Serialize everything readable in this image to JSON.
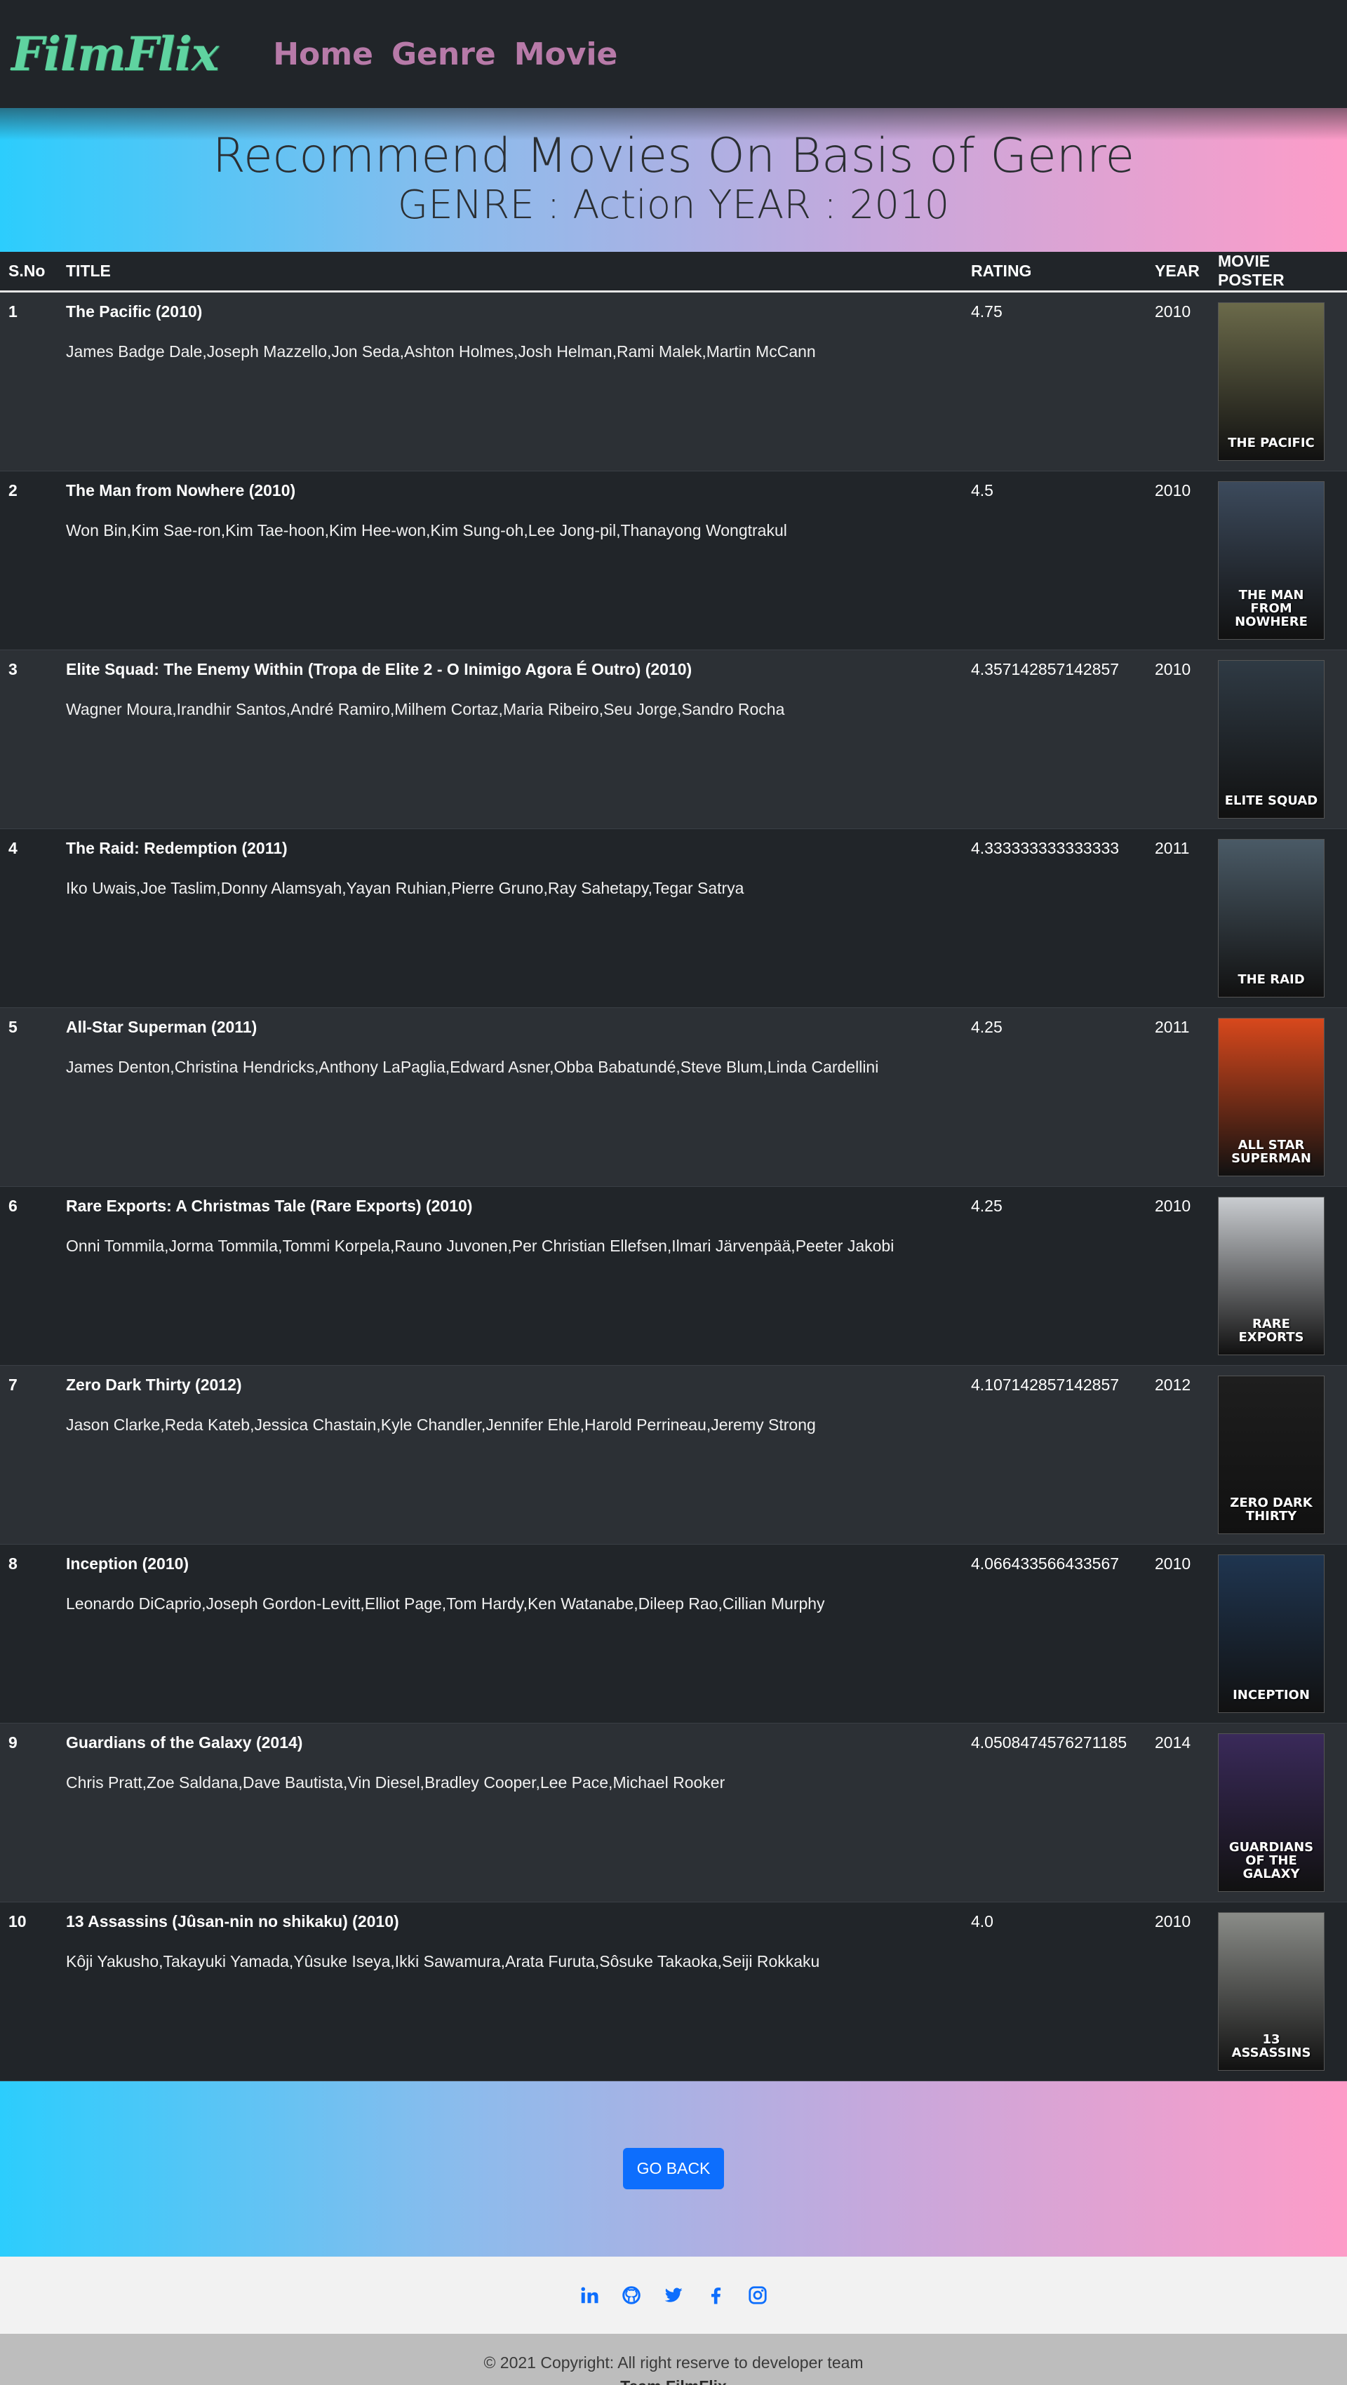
{
  "nav": {
    "brand": "FilmFlix",
    "links": [
      "Home",
      "Genre",
      "Movie"
    ]
  },
  "hero": {
    "title": "Recommend Movies On Basis of Genre",
    "subtitle": "GENRE : Action YEAR : 2010"
  },
  "table": {
    "headers": [
      "S.No",
      "TITLE",
      "RATING",
      "YEAR",
      "MOVIE POSTER"
    ],
    "rows": [
      {
        "sno": "1",
        "title": "The Pacific (2010)",
        "cast": "James Badge Dale,Joseph Mazzello,Jon Seda,Ashton Holmes,Josh Helman,Rami Malek,Martin McCann",
        "rating": "4.75",
        "year": "2010",
        "poster_label": "THE PACIFIC",
        "poster_color": "#6b6a4a"
      },
      {
        "sno": "2",
        "title": "The Man from Nowhere (2010)",
        "cast": "Won Bin,Kim Sae-ron,Kim Tae-hoon,Kim Hee-won,Kim Sung-oh,Lee Jong-pil,Thanayong Wongtrakul",
        "rating": "4.5",
        "year": "2010",
        "poster_label": "THE MAN FROM NOWHERE",
        "poster_color": "#3c4a5c"
      },
      {
        "sno": "3",
        "title": "Elite Squad: The Enemy Within (Tropa de Elite 2 - O Inimigo Agora É Outro) (2010)",
        "cast": "Wagner Moura,Irandhir Santos,André Ramiro,Milhem Cortaz,Maria Ribeiro,Seu Jorge,Sandro Rocha",
        "rating": "4.357142857142857",
        "year": "2010",
        "poster_label": "ELITE SQUAD",
        "poster_color": "#2f3a44"
      },
      {
        "sno": "4",
        "title": "The Raid: Redemption (2011)",
        "cast": "Iko Uwais,Joe Taslim,Donny Alamsyah,Yayan Ruhian,Pierre Gruno,Ray Sahetapy,Tegar Satrya",
        "rating": "4.333333333333333",
        "year": "2011",
        "poster_label": "THE RAID",
        "poster_color": "#4a5a66"
      },
      {
        "sno": "5",
        "title": "All-Star Superman (2011)",
        "cast": "James Denton,Christina Hendricks,Anthony LaPaglia,Edward Asner,Obba Babatundé,Steve Blum,Linda Cardellini",
        "rating": "4.25",
        "year": "2011",
        "poster_label": "ALL STAR SUPERMAN",
        "poster_color": "#d8481c"
      },
      {
        "sno": "6",
        "title": "Rare Exports: A Christmas Tale (Rare Exports) (2010)",
        "cast": "Onni Tommila,Jorma Tommila,Tommi Korpela,Rauno Juvonen,Per Christian Ellefsen,Ilmari Järvenpää,Peeter Jakobi",
        "rating": "4.25",
        "year": "2010",
        "poster_label": "RARE EXPORTS",
        "poster_color": "#c9ccd0"
      },
      {
        "sno": "7",
        "title": "Zero Dark Thirty (2012)",
        "cast": "Jason Clarke,Reda Kateb,Jessica Chastain,Kyle Chandler,Jennifer Ehle,Harold Perrineau,Jeremy Strong",
        "rating": "4.107142857142857",
        "year": "2012",
        "poster_label": "ZERO DARK THIRTY",
        "poster_color": "#1e1e1e"
      },
      {
        "sno": "8",
        "title": "Inception (2010)",
        "cast": "Leonardo DiCaprio,Joseph Gordon-Levitt,Elliot Page,Tom Hardy,Ken Watanabe,Dileep Rao,Cillian Murphy",
        "rating": "4.066433566433567",
        "year": "2010",
        "poster_label": "INCEPTION",
        "poster_color": "#1f3550"
      },
      {
        "sno": "9",
        "title": "Guardians of the Galaxy (2014)",
        "cast": "Chris Pratt,Zoe Saldana,Dave Bautista,Vin Diesel,Bradley Cooper,Lee Pace,Michael Rooker",
        "rating": "4.0508474576271185",
        "year": "2014",
        "poster_label": "GUARDIANS OF THE GALAXY",
        "poster_color": "#3a2a5a"
      },
      {
        "sno": "10",
        "title": "13 Assassins (Jûsan-nin no shikaku) (2010)",
        "cast": "Kôji Yakusho,Takayuki Yamada,Yûsuke Iseya,Ikki Sawamura,Arata Furuta,Sôsuke Takaoka,Seiji Rokkaku",
        "rating": "4.0",
        "year": "2010",
        "poster_label": "13 ASSASSINS",
        "poster_color": "#8a8c88"
      }
    ]
  },
  "back_button": "GO BACK",
  "social": [
    "linkedin-icon",
    "github-icon",
    "twitter-icon",
    "facebook-icon",
    "instagram-icon"
  ],
  "footer": {
    "copyright": "© 2021 Copyright: All right reserve to developer team",
    "team": "Team FilmFlix"
  },
  "colors": {
    "brand": "#5fd3a0",
    "nav_link": "#b77aa8",
    "button": "#0d6efd",
    "social": "#0d6efd"
  }
}
